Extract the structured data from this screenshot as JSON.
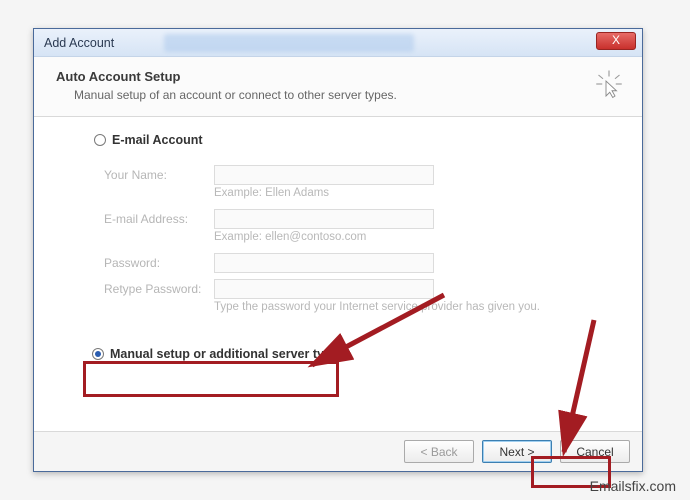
{
  "window": {
    "title": "Add Account",
    "close_label": "X"
  },
  "header": {
    "title": "Auto Account Setup",
    "subtitle": "Manual setup of an account or connect to other server types."
  },
  "options": {
    "email_label": "E-mail Account",
    "manual_label": "Manual setup or additional server types",
    "manual_selected": true
  },
  "form": {
    "your_name": {
      "label": "Your Name:",
      "value": "",
      "example": "Example: Ellen Adams"
    },
    "email": {
      "label": "E-mail Address:",
      "value": "",
      "example": "Example: ellen@contoso.com"
    },
    "password": {
      "label": "Password:",
      "value": ""
    },
    "retype_password": {
      "label": "Retype Password:",
      "value": ""
    },
    "hint": "Type the password your Internet service provider has given you."
  },
  "buttons": {
    "back": "< Back",
    "next": "Next >",
    "cancel": "Cancel"
  },
  "watermark": "Emailsfix.com",
  "annotations": {
    "highlight_color": "#a31c22"
  }
}
